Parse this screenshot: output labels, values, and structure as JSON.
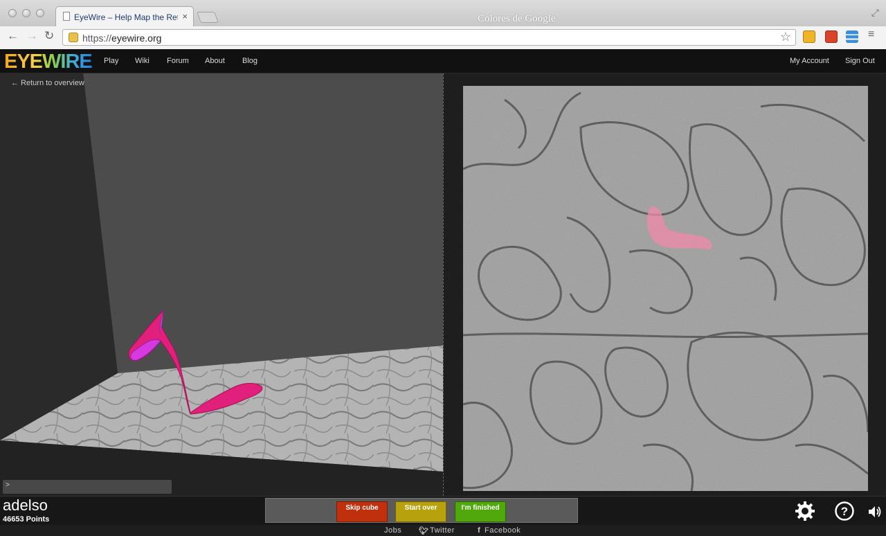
{
  "browser": {
    "tab_title": "EyeWire – Help Map the Retina",
    "tab_close": "×",
    "window_watermark": "Colores de Google",
    "url_protocol": "https://",
    "url_host": "eyewire.org"
  },
  "site": {
    "logo_text": "EYEWIRE",
    "nav": [
      "Play",
      "Wiki",
      "Forum",
      "About",
      "Blog"
    ],
    "account_label": "My Account",
    "signout_label": "Sign Out"
  },
  "viewer": {
    "return_link": "← Return to overview",
    "console_prompt": ">"
  },
  "player": {
    "name": "adelso",
    "points": "46653 Points"
  },
  "actions": {
    "skip": "Skip cube",
    "start_over": "Start over",
    "finished": "I'm finished",
    "skip_color": "#c1300d",
    "start_color": "#b7a20d",
    "finished_color": "#4fa80c"
  },
  "segment_colors": {
    "neuron_3d": "#e0207a",
    "neuron_3d_tip": "#d43ae0",
    "overlay_2d": "#f08aa8"
  },
  "footer": {
    "jobs": "Jobs",
    "twitter": "Twitter",
    "facebook": "Facebook"
  }
}
